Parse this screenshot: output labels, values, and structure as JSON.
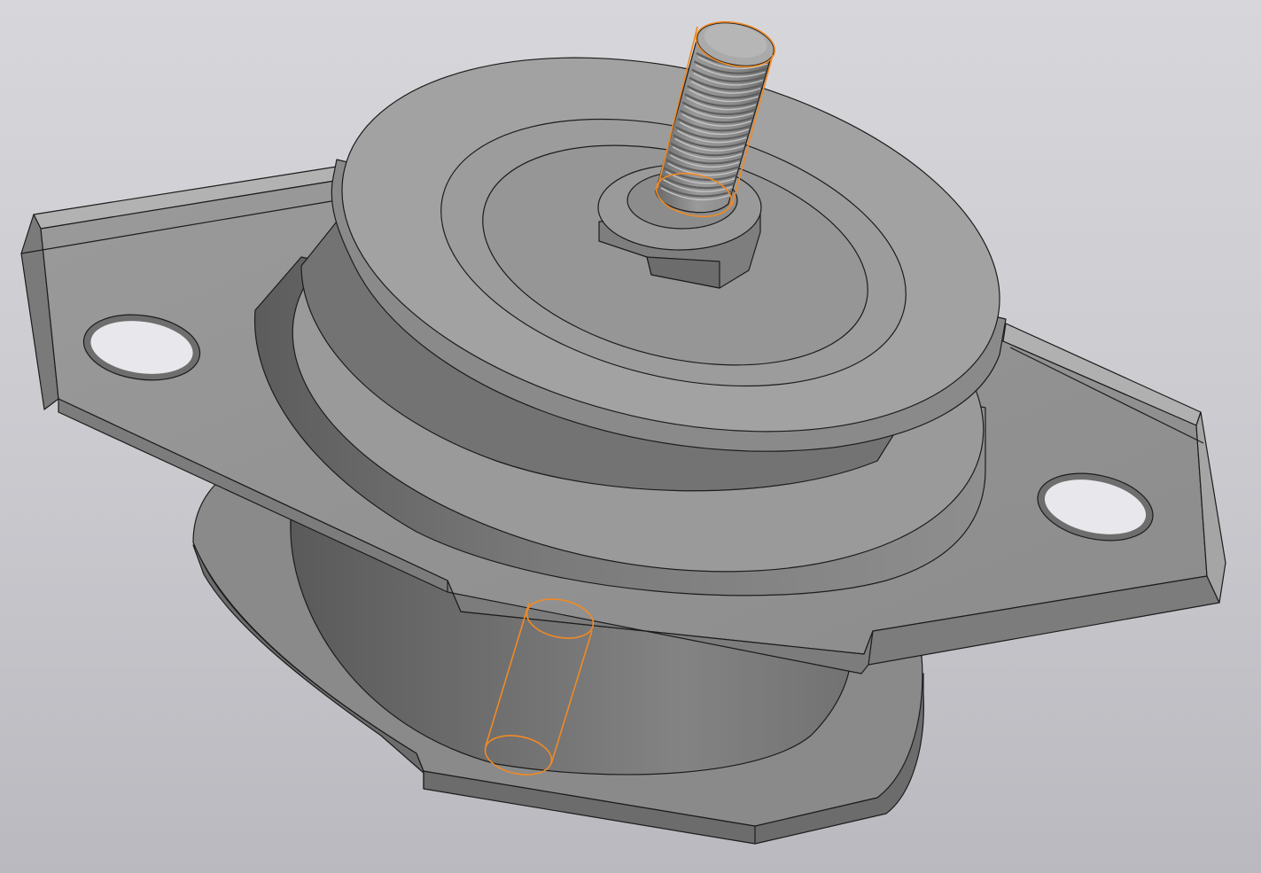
{
  "viewport": {
    "background_top": "#d7d7db",
    "background_bottom": "#b9b9bf",
    "selection_color": "#f08a24",
    "edge_color": "#1c1c1c"
  },
  "model": {
    "parts": [
      "base-plate",
      "rubber-cylinder",
      "mounting-bracket",
      "rubber-spring",
      "top-disc",
      "hex-nut",
      "threaded-stud",
      "locating-pin"
    ],
    "selected_parts": [
      "threaded-stud",
      "locating-pin"
    ]
  }
}
